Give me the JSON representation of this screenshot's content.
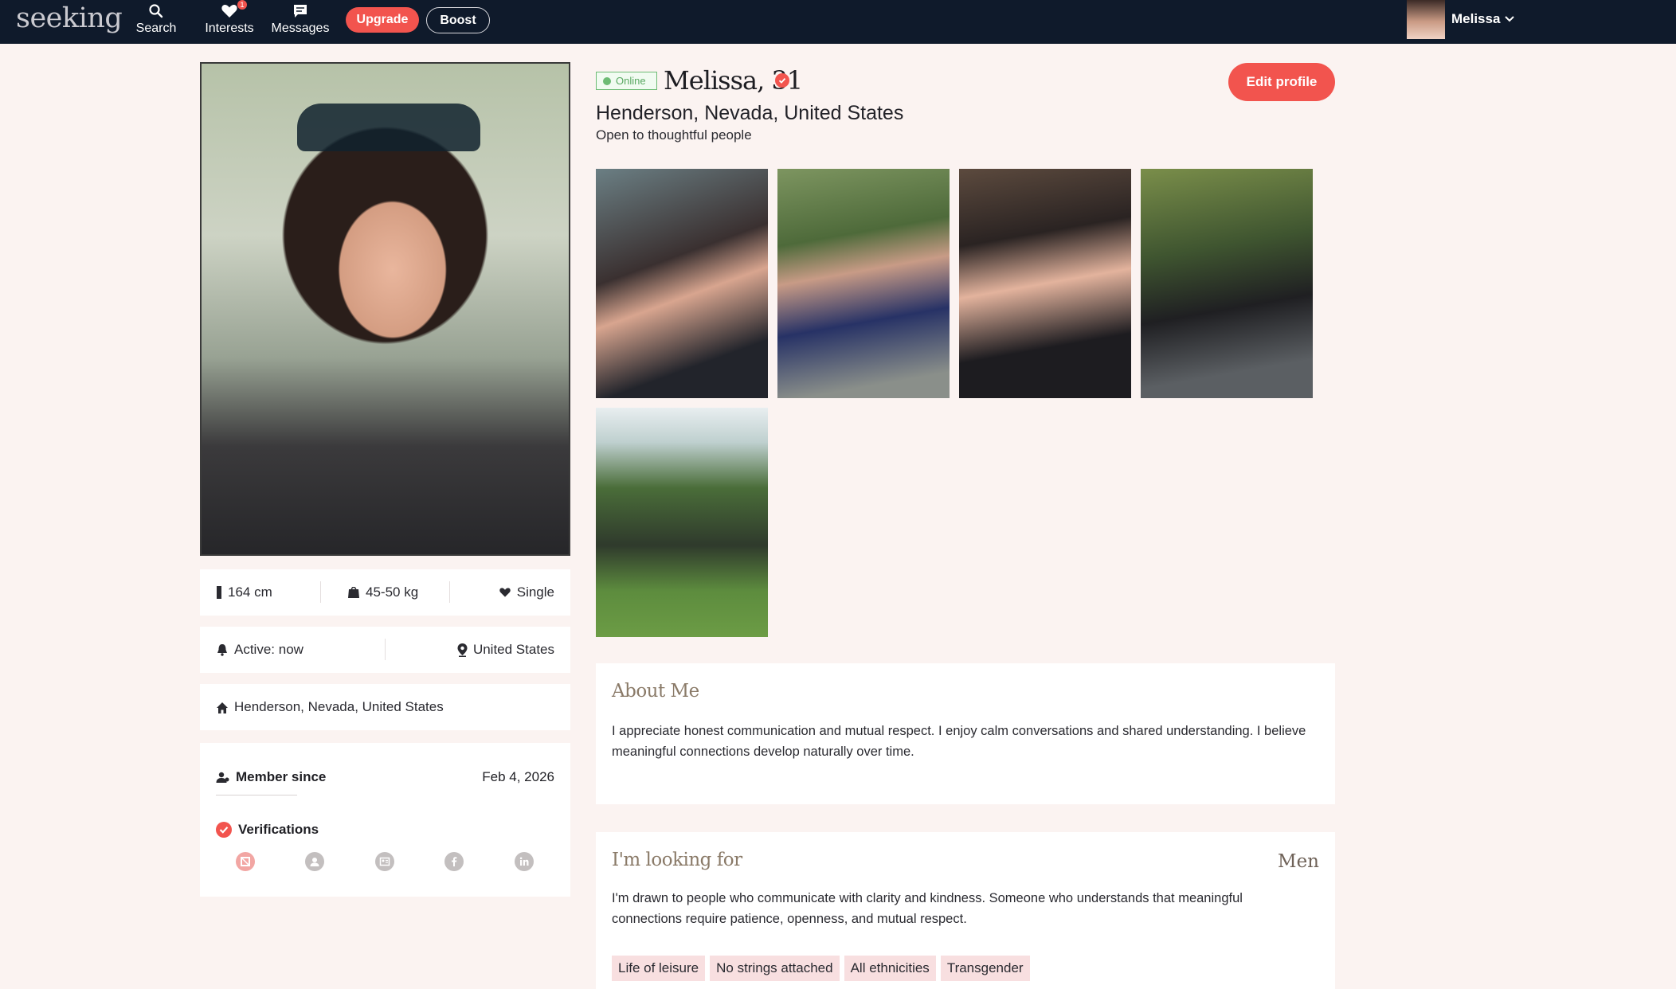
{
  "nav": {
    "logo": "seeking",
    "search_label": "Search",
    "interests_label": "Interests",
    "interests_badge": "1",
    "messages_label": "Messages",
    "upgrade_label": "Upgrade",
    "boost_label": "Boost",
    "user_name": "Melissa"
  },
  "profile": {
    "status": "Online",
    "name_age": "Melissa, 31",
    "location": "Henderson, Nevada, United States",
    "tagline": "Open to thoughtful people",
    "edit_label": "Edit profile"
  },
  "stats": {
    "height": "164 cm",
    "weight": "45-50 kg",
    "relationship": "Single",
    "active": "Active: now",
    "country": "United States",
    "hometown": "Henderson, Nevada, United States",
    "member_since_label": "Member since",
    "member_since_date": "Feb 4, 2026",
    "verifications_label": "Verifications"
  },
  "about": {
    "title": "About Me",
    "text": "I appreciate honest communication and mutual respect. I enjoy calm conversations and shared understanding. I believe meaningful connections develop naturally over time."
  },
  "looking": {
    "title": "I'm looking for",
    "gender": "Men",
    "text": "I'm drawn to people who communicate with clarity and kindness. Someone who understands that meaningful connections require patience, openness, and mutual respect.",
    "tags": [
      "Life of leisure",
      "No strings attached",
      "All ethnicities",
      "Transgender"
    ]
  },
  "colors": {
    "accent": "#f2544e",
    "nav_bg": "#0f1a2b",
    "page_bg": "#fbf3f1",
    "online": "#6dbb74"
  }
}
